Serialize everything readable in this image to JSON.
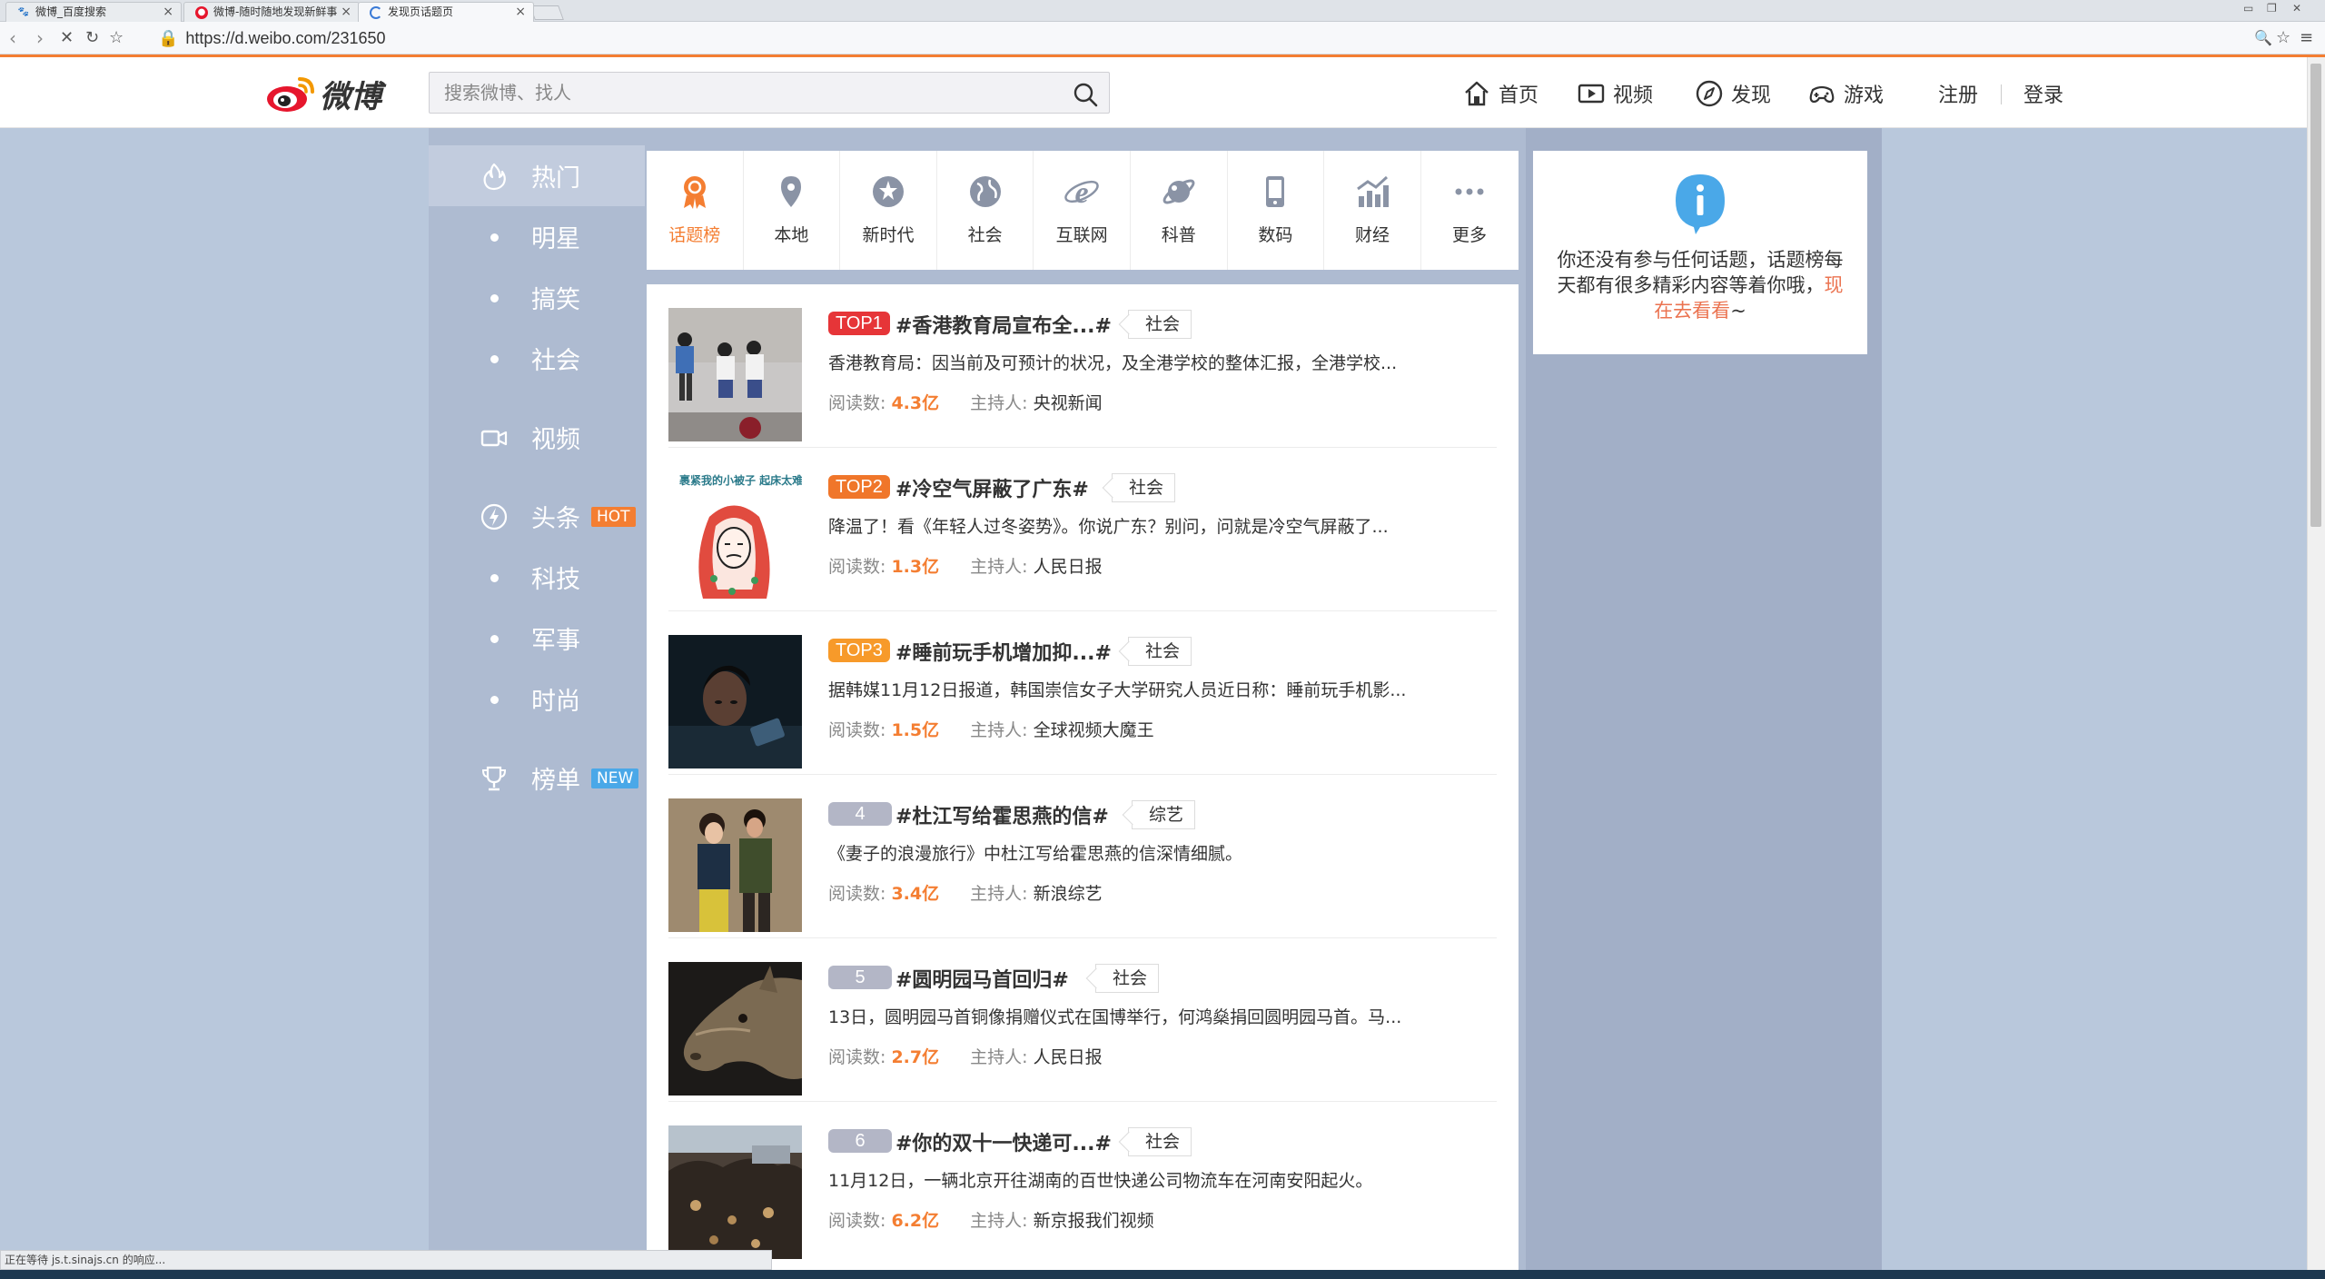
{
  "browser": {
    "tabs": [
      {
        "label": "微博_百度搜索",
        "icon": "baidu-paw-icon"
      },
      {
        "label": "微博-随时随地发现新鲜事",
        "icon": "weibo-icon"
      },
      {
        "label": "发现页话题页",
        "icon": "loading-icon"
      }
    ],
    "url_prefix": "https://",
    "url": "d.weibo.com/231650",
    "status": "正在等待 js.t.sinajs.cn 的响应..."
  },
  "header": {
    "logo_text": "微博",
    "search_placeholder": "搜索微博、找人",
    "nav": [
      {
        "label": "首页",
        "icon": "home-icon"
      },
      {
        "label": "视频",
        "icon": "video-icon"
      },
      {
        "label": "发现",
        "icon": "compass-icon"
      },
      {
        "label": "游戏",
        "icon": "gamepad-icon"
      }
    ],
    "register": "注册",
    "login": "登录"
  },
  "leftmenu": {
    "items": [
      {
        "label": "热门",
        "icon": "fire-icon"
      },
      {
        "label": "明星"
      },
      {
        "label": "搞笑"
      },
      {
        "label": "社会"
      },
      {
        "label": "视频",
        "icon": "video-icon"
      },
      {
        "label": "头条",
        "icon": "lightning-icon",
        "badge": "HOT"
      },
      {
        "label": "科技"
      },
      {
        "label": "军事"
      },
      {
        "label": "时尚"
      },
      {
        "label": "榜单",
        "icon": "trophy-icon",
        "badge": "NEW"
      }
    ]
  },
  "categories": [
    {
      "label": "话题榜",
      "icon": "ribbon-icon",
      "active": true
    },
    {
      "label": "本地",
      "icon": "location-pin-icon"
    },
    {
      "label": "新时代",
      "icon": "star-circle-icon"
    },
    {
      "label": "社会",
      "icon": "globe-icon"
    },
    {
      "label": "互联网",
      "icon": "ie-icon"
    },
    {
      "label": "科普",
      "icon": "planet-icon"
    },
    {
      "label": "数码",
      "icon": "phone-icon"
    },
    {
      "label": "财经",
      "icon": "chart-icon"
    },
    {
      "label": "更多",
      "icon": "more-dots-icon"
    }
  ],
  "topics": [
    {
      "rank": "TOP1",
      "title": "#香港教育局宣布全...#",
      "tag": "社会",
      "desc": "香港教育局：因当前及可预计的状况，及全港学校的整体汇报，全港学校...",
      "read_label": "阅读数:",
      "reads": "4.3亿",
      "host_label": "主持人:",
      "host": "央视新闻"
    },
    {
      "rank": "TOP2",
      "title": "#冷空气屏蔽了广东#",
      "tag": "社会",
      "desc": "降温了！看《年轻人过冬姿势》。你说广东？别问，问就是冷空气屏蔽了...",
      "read_label": "阅读数:",
      "reads": "1.3亿",
      "host_label": "主持人:",
      "host": "人民日报",
      "thumb_caption": "裹紧我的小被子 起床太难了！"
    },
    {
      "rank": "TOP3",
      "title": "#睡前玩手机增加抑...#",
      "tag": "社会",
      "desc": "据韩媒11月12日报道，韩国崇信女子大学研究人员近日称：睡前玩手机影...",
      "read_label": "阅读数:",
      "reads": "1.5亿",
      "host_label": "主持人:",
      "host": "全球视频大魔王"
    },
    {
      "rank": "4",
      "title": "#杜江写给霍思燕的信#",
      "tag": "综艺",
      "desc": "《妻子的浪漫旅行》中杜江写给霍思燕的信深情细腻。",
      "read_label": "阅读数:",
      "reads": "3.4亿",
      "host_label": "主持人:",
      "host": "新浪综艺"
    },
    {
      "rank": "5",
      "title": "#圆明园马首回归#",
      "tag": "社会",
      "desc": "13日，圆明园马首铜像捐赠仪式在国博举行，何鸿燊捐回圆明园马首。马...",
      "read_label": "阅读数:",
      "reads": "2.7亿",
      "host_label": "主持人:",
      "host": "人民日报"
    },
    {
      "rank": "6",
      "title": "#你的双十一快递可...#",
      "tag": "社会",
      "desc": "11月12日，一辆北京开往湖南的百世快递公司物流车在河南安阳起火。",
      "read_label": "阅读数:",
      "reads": "6.2亿",
      "host_label": "主持人:",
      "host": "新京报我们视频"
    }
  ],
  "info": {
    "text": "你还没有参与任何话题，话题榜每天都有很多精彩内容等着你哦，",
    "link": "现在去看看",
    "suffix": "~"
  },
  "colors": {
    "accent": "#f47e32",
    "hot_rank": "#e63538"
  }
}
